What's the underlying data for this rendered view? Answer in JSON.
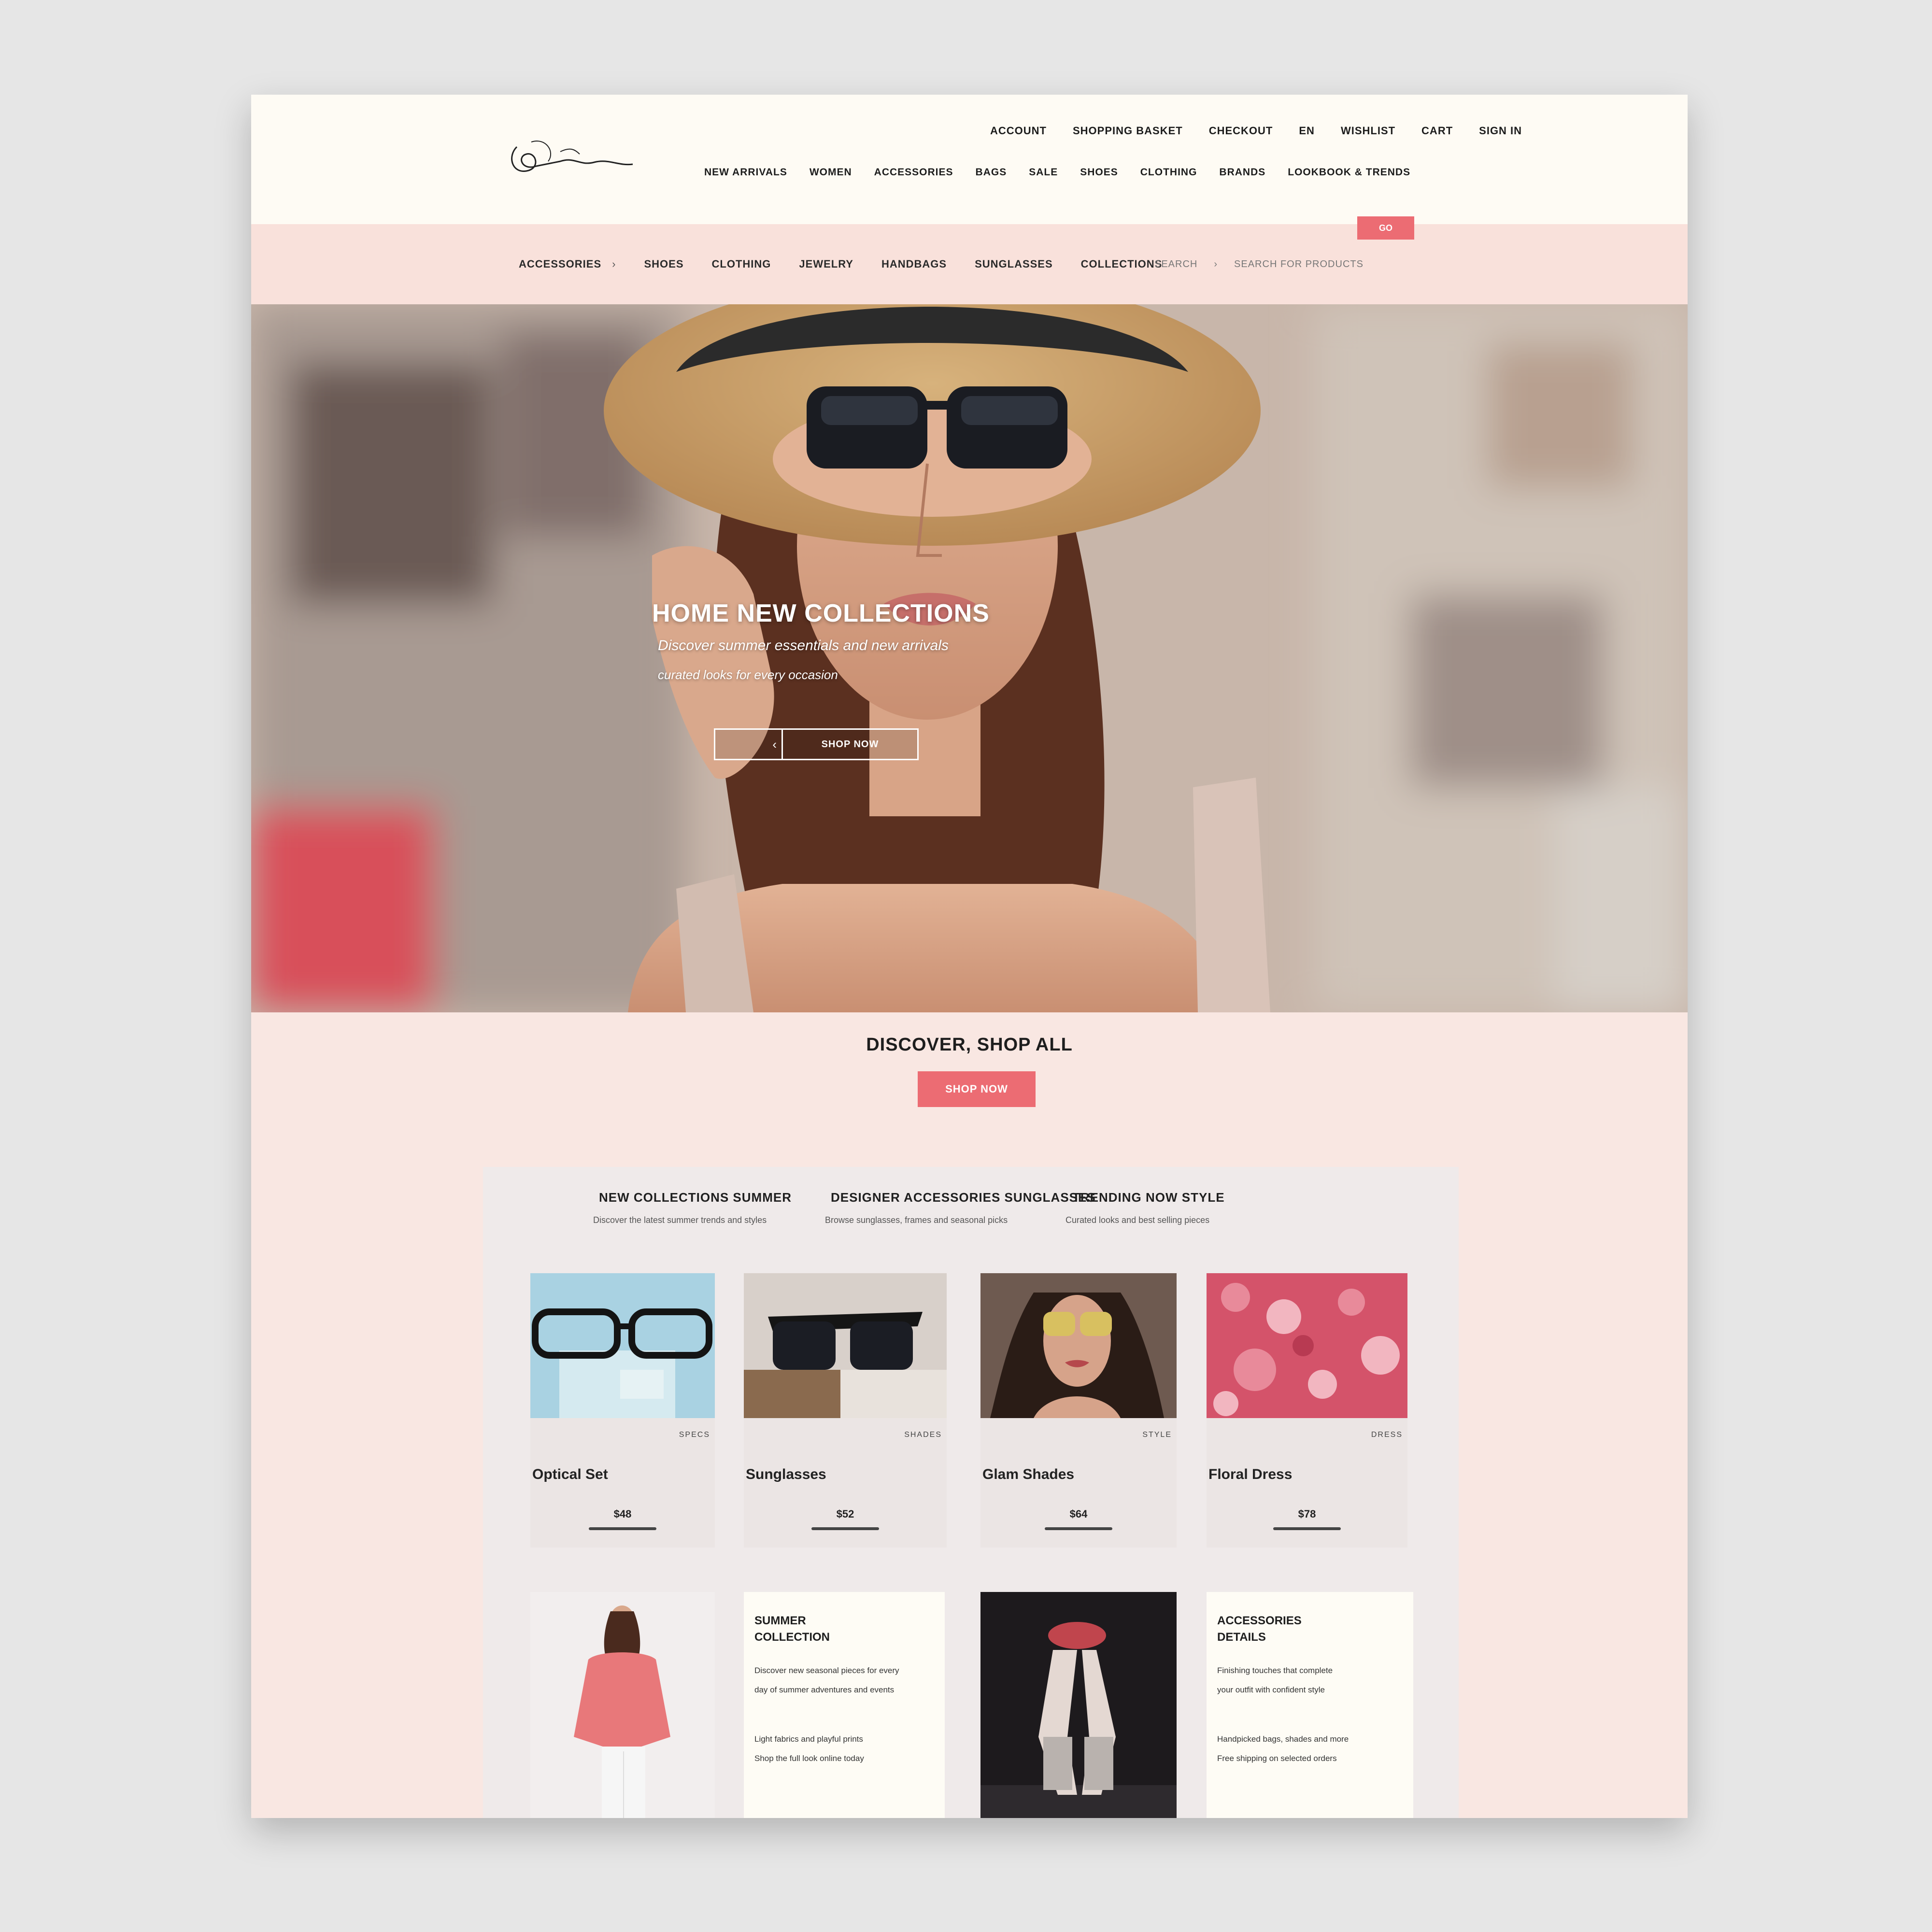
{
  "header": {
    "logo_text": "Vosalin",
    "utility_links": [
      "ACCOUNT",
      "SHOPPING BASKET",
      "CHECKOUT",
      "EN",
      "WISHLIST",
      "CART",
      "SIGN IN"
    ],
    "main_nav": [
      "NEW ARRIVALS",
      "WOMEN",
      "ACCESSORIES",
      "BAGS",
      "SALE",
      "SHOES",
      "CLOTHING",
      "BRANDS",
      "LOOKBOOK & TRENDS"
    ]
  },
  "category_bar": {
    "items": [
      "ACCESSORIES",
      "SHOES",
      "CLOTHING",
      "JEWELRY",
      "HANDBAGS",
      "SUNGLASSES",
      "COLLECTIONS"
    ],
    "right_items": [
      "SEARCH",
      "SEARCH FOR PRODUCTS"
    ],
    "button_label": "GO"
  },
  "hero": {
    "title": "HOME NEW COLLECTIONS",
    "subtitle_1": "Discover summer essentials and new arrivals",
    "subtitle_2": "curated looks for every occasion",
    "button_icon": "‹",
    "button_label": "SHOP NOW"
  },
  "promo": {
    "title": "DISCOVER, SHOP ALL",
    "button_label": "SHOP NOW"
  },
  "columns": [
    {
      "heading": "NEW COLLECTIONS SUMMER",
      "sub": "Discover the latest summer trends and styles"
    },
    {
      "heading": "DESIGNER ACCESSORIES SUNGLASSES",
      "sub": "Browse sunglasses, frames and seasonal picks"
    },
    {
      "heading": "TRENDING NOW STYLE",
      "sub": "Curated looks and best selling pieces"
    }
  ],
  "products": [
    {
      "image": "eyeglasses",
      "meta": "SPECS",
      "name": "Optical Set",
      "price": "$48"
    },
    {
      "image": "sunglasses",
      "meta": "SHADES",
      "name": "Sunglasses",
      "price": "$52"
    },
    {
      "image": "model-shades",
      "meta": "STYLE",
      "name": "Glam Shades",
      "price": "$64"
    },
    {
      "image": "floral-dress",
      "meta": "DRESS",
      "name": "Floral Dress",
      "price": "$78"
    }
  ],
  "features": [
    {
      "image": "fashion-model",
      "type": "image"
    },
    {
      "type": "text",
      "title_1": "SUMMER",
      "title_2": "COLLECTION",
      "lines": [
        "Discover new seasonal pieces for every",
        "day of summer adventures and events",
        "Light fabrics and playful prints",
        "Shop the full look online today"
      ]
    },
    {
      "image": "sandals",
      "type": "image"
    },
    {
      "type": "text",
      "title_1": "ACCESSORIES",
      "title_2": "DETAILS",
      "lines": [
        "Finishing touches that complete",
        "your outfit with confident style",
        "Handpicked bags, shades and more",
        "Free shipping on selected orders"
      ]
    }
  ],
  "colors": {
    "accent": "#ec6c73",
    "page_bg": "#f9e7e2",
    "header_bg": "#fefbf4",
    "panel_bg": "#efeaea"
  }
}
